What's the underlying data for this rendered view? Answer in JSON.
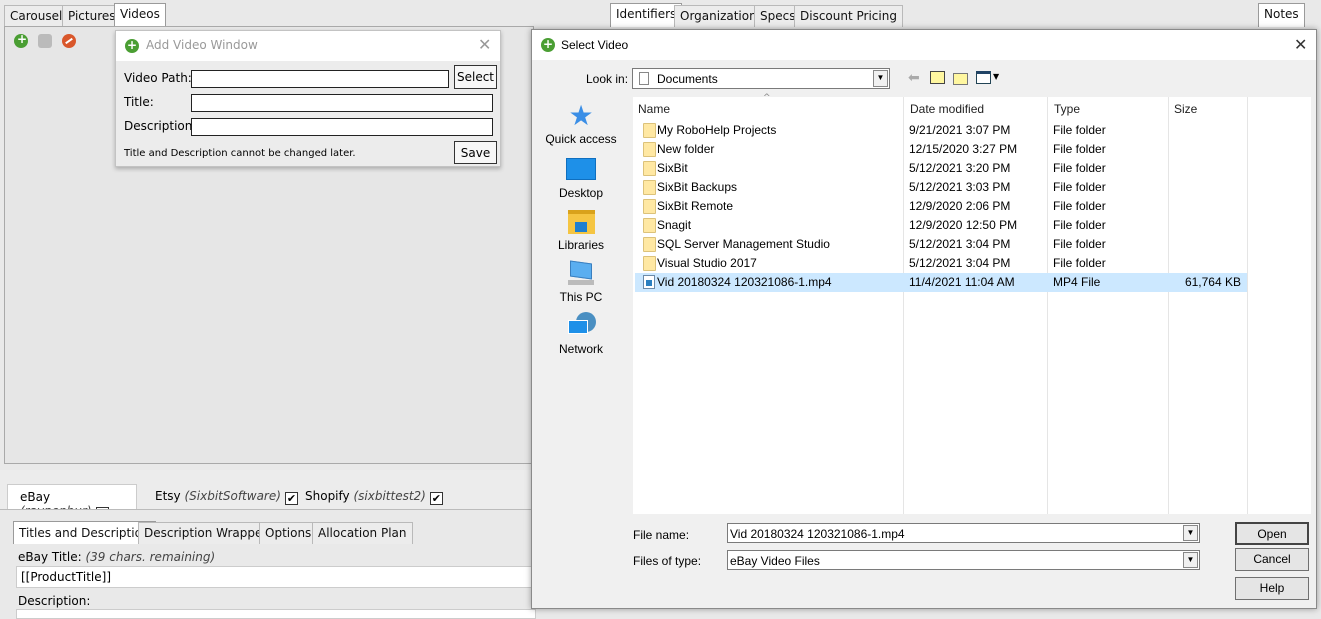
{
  "left_tabs": [
    "Carousel",
    "Pictures",
    "Videos"
  ],
  "left_active_tab": "Videos",
  "toolbar_icons": [
    "add-icon",
    "settings-icon",
    "remove-icon"
  ],
  "right_tabs": [
    "Identifiers",
    "Organization",
    "Specs",
    "Discount Pricing"
  ],
  "notes_tab": "Notes",
  "add_video_window": {
    "title": "Add Video Window",
    "video_path_label": "Video Path:",
    "video_path_value": "",
    "select_button": "Select",
    "title_label": "Title:",
    "title_value": "",
    "description_label": "Description:",
    "description_value": "",
    "note": "Title and Description cannot be changed later.",
    "save_button": "Save"
  },
  "marketplace_tabs": [
    {
      "name": "eBay",
      "account": "(raypenbur)",
      "checked": "✔"
    },
    {
      "name": "Etsy",
      "account": "(SixbitSoftware)",
      "checked": "✔"
    },
    {
      "name": "Shopify",
      "account": "(sixbittest2)",
      "checked": "✔"
    }
  ],
  "sub_tabs": [
    "Titles and Description",
    "Description Wrapper",
    "Options",
    "Allocation Plan"
  ],
  "ebay_title_label": "eBay Title:",
  "ebay_title_hint": "(39  chars. remaining)",
  "ebay_title_value": "[[ProductTitle]]",
  "description_label": "Description:",
  "select_video": {
    "title": "Select Video",
    "look_in_label": "Look in:",
    "look_in_value": "Documents",
    "nav": [
      "Quick access",
      "Desktop",
      "Libraries",
      "This PC",
      "Network"
    ],
    "columns": [
      "Name",
      "Date modified",
      "Type",
      "Size"
    ],
    "files": [
      {
        "name": "My RoboHelp Projects",
        "date": "9/21/2021 3:07 PM",
        "type": "File folder",
        "size": ""
      },
      {
        "name": "New folder",
        "date": "12/15/2020 3:27 PM",
        "type": "File folder",
        "size": ""
      },
      {
        "name": "SixBit",
        "date": "5/12/2021 3:20 PM",
        "type": "File folder",
        "size": ""
      },
      {
        "name": "SixBit Backups",
        "date": "5/12/2021 3:03 PM",
        "type": "File folder",
        "size": ""
      },
      {
        "name": "SixBit Remote",
        "date": "12/9/2020 2:06 PM",
        "type": "File folder",
        "size": ""
      },
      {
        "name": "Snagit",
        "date": "12/9/2020 12:50 PM",
        "type": "File folder",
        "size": ""
      },
      {
        "name": "SQL Server Management Studio",
        "date": "5/12/2021 3:04 PM",
        "type": "File folder",
        "size": ""
      },
      {
        "name": "Visual Studio 2017",
        "date": "5/12/2021 3:04 PM",
        "type": "File folder",
        "size": ""
      },
      {
        "name": "Vid 20180324 120321086-1.mp4",
        "date": "11/4/2021 11:04 AM",
        "type": "MP4 File",
        "size": "61,764 KB"
      }
    ],
    "file_name_label": "File name:",
    "file_name_value": "Vid 20180324 120321086-1.mp4",
    "files_of_type_label": "Files of type:",
    "files_of_type_value": "eBay Video Files",
    "open_button": "Open",
    "cancel_button": "Cancel",
    "help_button": "Help"
  }
}
